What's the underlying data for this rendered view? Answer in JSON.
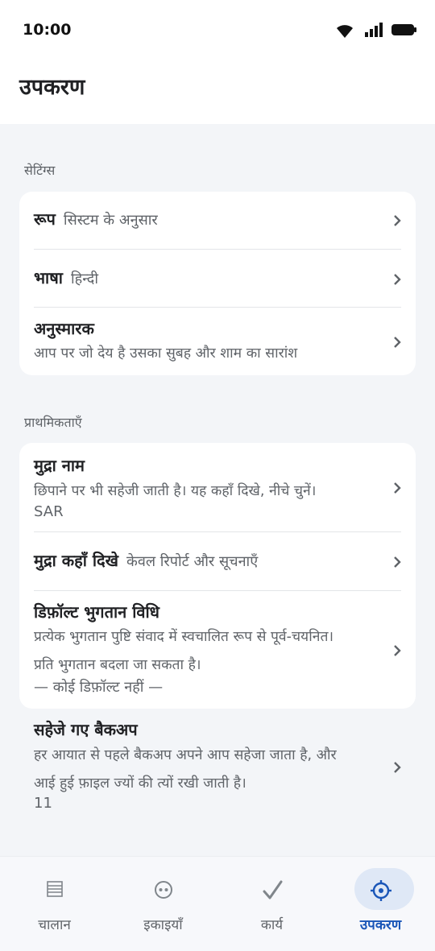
{
  "status_bar": {
    "time": "10:00"
  },
  "header": {
    "title": "उपकरण"
  },
  "sections": {
    "settings": {
      "title": "सेटिंग्स",
      "appearance": {
        "label": "रूप",
        "value": "सिस्टम के अनुसार"
      },
      "language": {
        "label": "भाषा",
        "value": "हिन्दी"
      },
      "reminders": {
        "label": "अनुस्मारक",
        "description": "आप पर जो देय है उसका सुबह और शाम का सारांश"
      }
    },
    "preferences": {
      "title": "प्राथमिकताएँ",
      "currency_name": {
        "label": "मुद्रा नाम",
        "description": "छिपाने पर भी सहेजी जाती है। यह कहाँ दिखे, नीचे चुनें।",
        "value": "SAR"
      },
      "currency_display": {
        "label": "मुद्रा कहाँ दिखे",
        "value": "केवल रिपोर्ट और सूचनाएँ"
      },
      "default_payment": {
        "label": "डिफ़ॉल्ट भुगतान विधि",
        "description_line1": "प्रत्येक भुगतान पुष्टि संवाद में स्वचालित रूप से पूर्व-चयनित।",
        "description_line2": "प्रति भुगतान बदला जा सकता है।",
        "value": "— कोई डिफ़ॉल्ट नहीं —"
      },
      "saved_backups": {
        "label": "सहेजे गए बैकअप",
        "description_line1": "हर आयात से पहले बैकअप अपने आप सहेजा जाता है, और",
        "description_line2": "आई हुई फ़ाइल ज्यों की त्यों रखी जाती है।",
        "value": "11"
      }
    }
  },
  "bottom_nav": {
    "items": [
      {
        "label": "चालान",
        "icon": "list-icon"
      },
      {
        "label": "इकाइयाँ",
        "icon": "units-icon"
      },
      {
        "label": "कार्य",
        "icon": "check-icon"
      },
      {
        "label": "उपकरण",
        "icon": "gear-icon",
        "active": true
      }
    ]
  },
  "colors": {
    "accent": "#1a56b8",
    "active_pill": "#dfe8f6",
    "background": "#f3f5f8"
  }
}
